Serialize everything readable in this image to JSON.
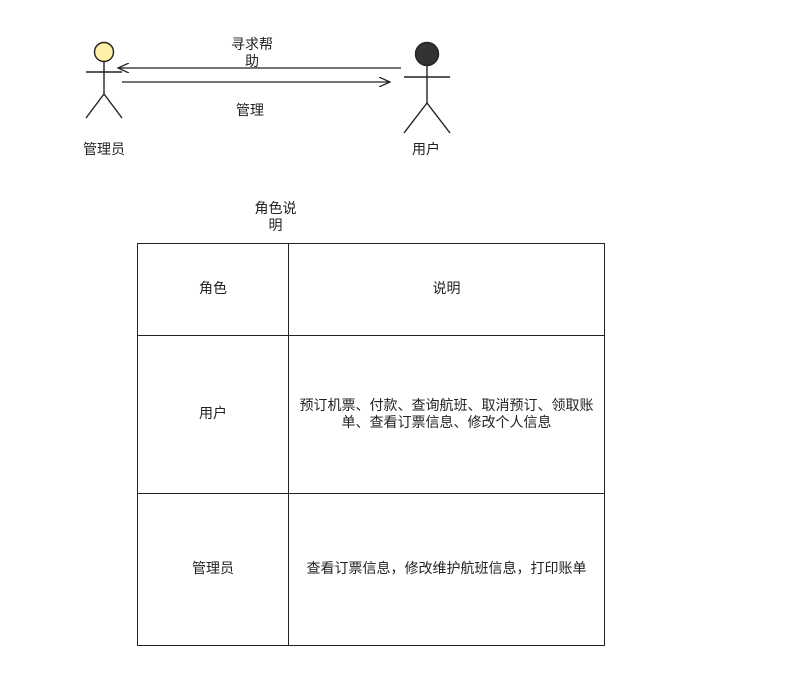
{
  "actors": {
    "admin": {
      "label": "管理员",
      "head_color": "#fff2a8"
    },
    "user": {
      "label": "用户",
      "head_color": "#333333"
    }
  },
  "arrows": {
    "help_label": "寻求帮助",
    "manage_label": "管理"
  },
  "table": {
    "caption": "角色说明",
    "header": {
      "role": "角色",
      "desc": "说明"
    },
    "rows": [
      {
        "role": "用户",
        "desc": "预订机票、付款、查询航班、取消预订、领取账单、查看订票信息、修改个人信息"
      },
      {
        "role": "管理员",
        "desc": "查看订票信息，修改维护航班信息，打印账单"
      }
    ]
  }
}
